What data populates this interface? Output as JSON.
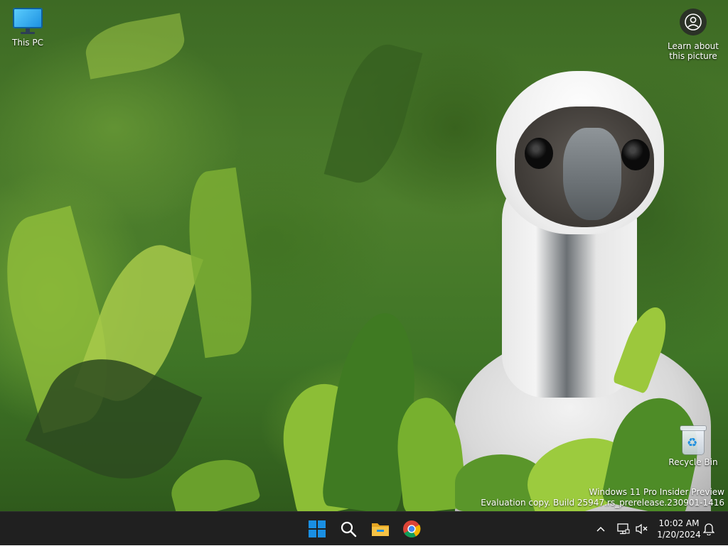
{
  "desktop": {
    "icons": {
      "this_pc": {
        "label": "This PC",
        "icon": "monitor-icon"
      },
      "recycle_bin": {
        "label": "Recycle Bin",
        "icon": "recycle-bin-icon"
      },
      "learn_about": {
        "line1": "Learn about",
        "line2": "this picture",
        "icon": "camera-info-icon"
      }
    },
    "watermark": {
      "line1": "Windows 11 Pro Insider Preview",
      "line2": "Evaluation copy. Build 25947.rs_prerelease.230901-1416"
    }
  },
  "taskbar": {
    "apps": [
      {
        "name": "Start",
        "icon": "windows-start-icon"
      },
      {
        "name": "Search",
        "icon": "search-icon"
      },
      {
        "name": "File Explorer",
        "icon": "folder-icon"
      },
      {
        "name": "Google Chrome",
        "icon": "chrome-icon"
      }
    ],
    "tray": {
      "overflow_icon": "chevron-up-icon",
      "network_icon": "network-icon",
      "volume_icon": "volume-muted-icon",
      "notification_icon": "bell-icon"
    },
    "clock": {
      "time": "10:02 AM",
      "date": "1/20/2024"
    }
  },
  "colors": {
    "taskbar_bg": "#202020",
    "start_blue": "#1a8fe3",
    "folder_yellow": "#f6c244"
  }
}
